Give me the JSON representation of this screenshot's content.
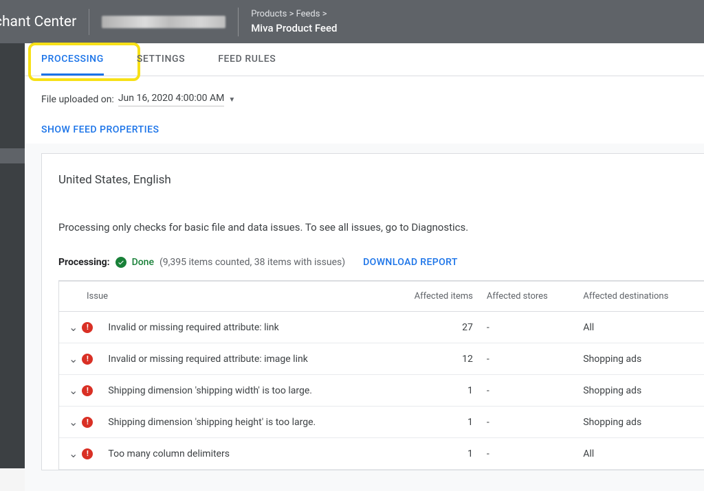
{
  "header": {
    "logo_text": "chant Center",
    "breadcrumb_path": "Products  >  Feeds  >",
    "breadcrumb_title": "Miva Product Feed"
  },
  "tabs": {
    "processing": "PROCESSING",
    "settings": "SETTINGS",
    "feed_rules": "FEED RULES"
  },
  "subheader": {
    "upload_prefix": "File uploaded on: ",
    "upload_date": "Jun 16, 2020 4:00:00 AM",
    "show_properties": "SHOW FEED PROPERTIES"
  },
  "card": {
    "locale": "United States, English",
    "description": "Processing only checks for basic file and data issues. To see all issues, go to Diagnostics.",
    "processing_label": "Processing:",
    "done_label": "Done",
    "count_summary": "(9,395 items counted, 38 items with issues)",
    "download_report": "DOWNLOAD REPORT"
  },
  "table": {
    "headers": {
      "issue": "Issue",
      "affected_items": "Affected items",
      "affected_stores": "Affected stores",
      "affected_destinations": "Affected destinations"
    },
    "rows": [
      {
        "issue": "Invalid or missing required attribute: link",
        "items": "27",
        "stores": "-",
        "dest": "All"
      },
      {
        "issue": "Invalid or missing required attribute: image link",
        "items": "12",
        "stores": "-",
        "dest": "Shopping ads"
      },
      {
        "issue": "Shipping dimension 'shipping width' is too large.",
        "items": "1",
        "stores": "-",
        "dest": "Shopping ads"
      },
      {
        "issue": "Shipping dimension 'shipping height' is too large.",
        "items": "1",
        "stores": "-",
        "dest": "Shopping ads"
      },
      {
        "issue": "Too many column delimiters",
        "items": "1",
        "stores": "-",
        "dest": "All"
      }
    ]
  }
}
